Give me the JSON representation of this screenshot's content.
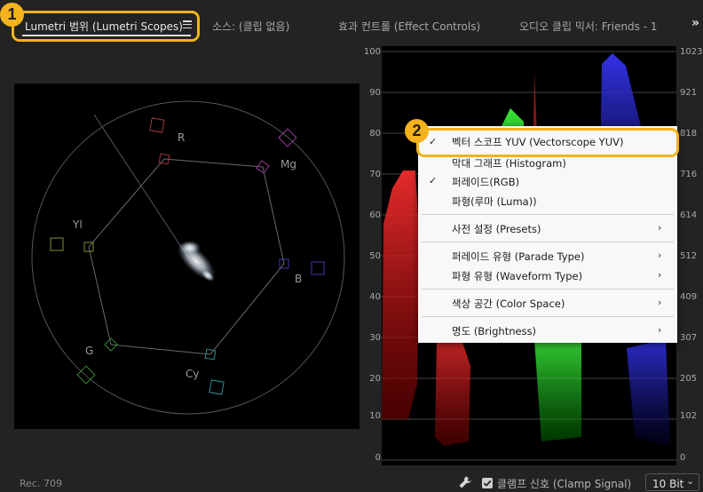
{
  "tabs": [
    {
      "label": "Lumetri 범위 (Lumetri Scopes)",
      "active": true
    },
    {
      "label": "소스: (클립 없음)"
    },
    {
      "label": "효과 컨트롤 (Effect Controls)"
    },
    {
      "label": "오디오 클립 믹서: Friends - 1"
    }
  ],
  "more_icon": "»",
  "callouts": {
    "one": "1",
    "two": "2"
  },
  "vectorscope": {
    "labels": {
      "r": "R",
      "mg": "Mg",
      "b": "B",
      "cy": "Cy",
      "g": "G",
      "yl": "Yl"
    }
  },
  "waveform": {
    "left_ticks": [
      "100",
      "90",
      "80",
      "70",
      "60",
      "50",
      "40",
      "30",
      "20",
      "10",
      "0"
    ],
    "right_ticks": [
      "1023",
      "921",
      "818",
      "716",
      "614",
      "512",
      "409",
      "307",
      "205",
      "102",
      "0"
    ]
  },
  "context_menu": {
    "vectorscope": "벡터 스코프 YUV (Vectorscope YUV)",
    "histogram": "막대 그래프 (Histogram)",
    "parade": "퍼레이드(RGB)",
    "waveform_luma": "파형(루마 (Luma))",
    "presets": "사전 설정 (Presets)",
    "parade_type": "퍼레이드 유형 (Parade Type)",
    "waveform_type": "파형 유형 (Waveform Type)",
    "color_space": "색상 공간 (Color Space)",
    "brightness": "명도 (Brightness)",
    "check_glyph": "✓",
    "submenu_glyph": "›"
  },
  "footer": {
    "color_space": "Rec. 709",
    "clamp_label": "클램프 신호 (Clamp Signal)",
    "clamp_checked": true,
    "bit_depth": "10 Bit"
  },
  "colors": {
    "accent": "#f3b21e",
    "panel": "#232323"
  }
}
